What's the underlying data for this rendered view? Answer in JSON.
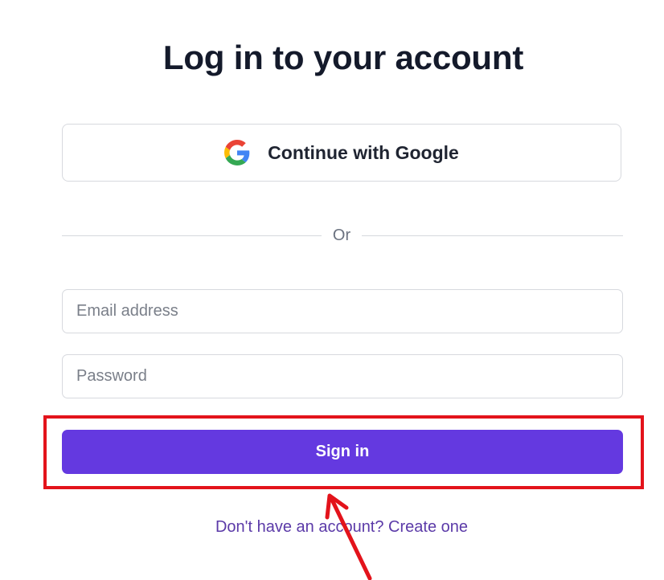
{
  "heading": "Log in to your account",
  "google_button": {
    "label": "Continue with Google",
    "icon": "google-logo-icon"
  },
  "divider_text": "Or",
  "email_field": {
    "placeholder": "Email address",
    "value": ""
  },
  "password_field": {
    "placeholder": "Password",
    "value": ""
  },
  "signin_button": {
    "label": "Sign in"
  },
  "create_account_link": "Don't have an account? Create one",
  "annotations": {
    "highlight_color": "#e3131b",
    "arrow_color": "#e3131b"
  },
  "colors": {
    "primary": "#6439e0",
    "link": "#5b3aa8",
    "heading": "#141a2b"
  }
}
